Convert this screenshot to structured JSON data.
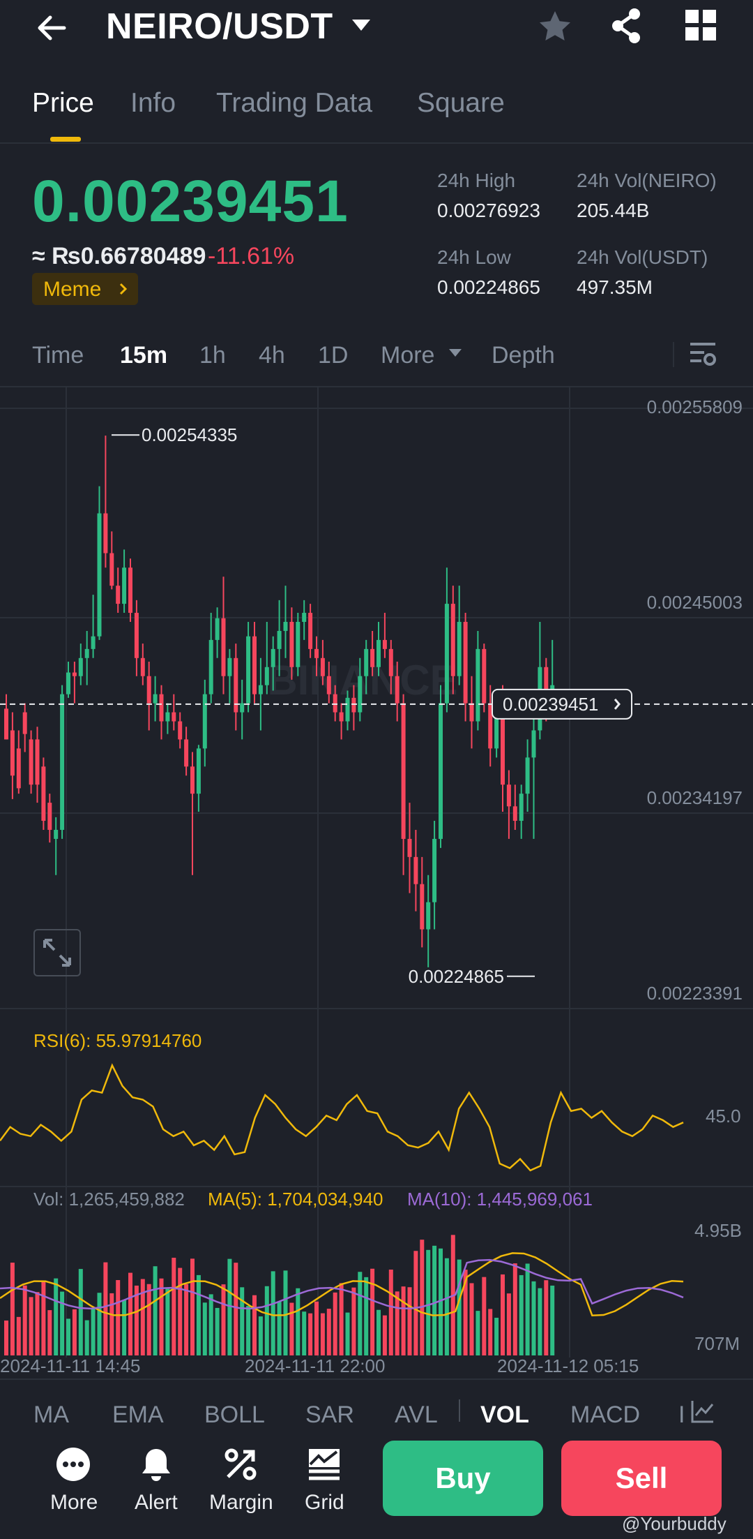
{
  "header": {
    "pair": "NEIRO/USDT",
    "back_icon": "arrow-left-icon",
    "favorite_icon": "star-icon",
    "share_icon": "share-icon",
    "grid_icon": "grid-icon"
  },
  "tabs": [
    {
      "label": "Price",
      "active": true
    },
    {
      "label": "Info"
    },
    {
      "label": "Trading Data"
    },
    {
      "label": "Square"
    }
  ],
  "price": {
    "last": "0.00239451",
    "fiat": "≈ ₨0.66780489",
    "change": "-11.61%",
    "tag": "Meme"
  },
  "stats": {
    "high_label": "24h High",
    "high_value": "0.00276923",
    "low_label": "24h Low",
    "low_value": "0.00224865",
    "vol_base_label": "24h Vol(NEIRO)",
    "vol_base_value": "205.44B",
    "vol_quote_label": "24h Vol(USDT)",
    "vol_quote_value": "497.35M"
  },
  "intervals": {
    "items": [
      "Time",
      "15m",
      "1h",
      "4h",
      "1D",
      "More",
      "Depth"
    ],
    "active": "15m"
  },
  "chart": {
    "axis_labels": [
      "0.00255809",
      "0.00245003",
      "0.00234197",
      "0.00223391"
    ],
    "high_marker": "0.00254335",
    "low_marker": "0.00224865",
    "current_price": "0.00239451",
    "watermark": "BINANCE"
  },
  "rsi": {
    "label": "RSI(6): 55.97914760",
    "axis": "45.0"
  },
  "volume": {
    "vol": "Vol: 1,265,459,882",
    "ma5": "MA(5): 1,704,034,940",
    "ma10": "MA(10): 1,445,969,061",
    "axis_top": "4.95B",
    "axis_bottom": "707M"
  },
  "time_axis": [
    "2024-11-11 14:45",
    "2024-11-11 22:00",
    "2024-11-12 05:15"
  ],
  "indicator_tabs": {
    "items": [
      "MA",
      "EMA",
      "BOLL",
      "SAR",
      "AVL",
      "VOL",
      "MACD",
      "I"
    ],
    "active": "VOL"
  },
  "bottom_actions": [
    {
      "label": "More",
      "icon": "more-dots-icon"
    },
    {
      "label": "Alert",
      "icon": "bell-icon"
    },
    {
      "label": "Margin",
      "icon": "margin-icon"
    },
    {
      "label": "Grid",
      "icon": "grid-bot-icon"
    }
  ],
  "buttons": {
    "buy": "Buy",
    "sell": "Sell"
  },
  "colors": {
    "up": "#2ebd85",
    "down": "#f6465d",
    "accent": "#f0b90b",
    "ma10": "#9c6ad6",
    "background": "#1e2129"
  },
  "chart_data": {
    "type": "candlestick",
    "y_range": [
      0.00223391,
      0.00255809
    ],
    "y_ticks": [
      0.00255809,
      0.00245003,
      0.00234197,
      0.00223391
    ],
    "high": 0.00254335,
    "low": 0.00224865,
    "last": 0.00239451,
    "candles": [
      [
        0.002392,
        0.0024,
        0.002375,
        0.002375
      ],
      [
        0.00238,
        0.00239,
        0.002342,
        0.002355
      ],
      [
        0.00237,
        0.00238,
        0.002345,
        0.002348
      ],
      [
        0.00239,
        0.002395,
        0.002368,
        0.002378
      ],
      [
        0.002375,
        0.00238,
        0.002345,
        0.00235
      ],
      [
        0.002375,
        0.002382,
        0.00234,
        0.00235
      ],
      [
        0.00236,
        0.002365,
        0.002325,
        0.00233
      ],
      [
        0.00234,
        0.002345,
        0.002318,
        0.002325
      ],
      [
        0.00232,
        0.002332,
        0.0023,
        0.002325
      ],
      [
        0.002325,
        0.002405,
        0.00232,
        0.0024
      ],
      [
        0.0024,
        0.002418,
        0.002398,
        0.002412
      ],
      [
        0.002412,
        0.002418,
        0.002395,
        0.00241
      ],
      [
        0.00241,
        0.002428,
        0.002405,
        0.00242
      ],
      [
        0.00242,
        0.002435,
        0.002405,
        0.002425
      ],
      [
        0.002425,
        0.002455,
        0.00242,
        0.002432
      ],
      [
        0.002432,
        0.002515,
        0.00243,
        0.0025
      ],
      [
        0.0025,
        0.002543,
        0.00247,
        0.002478
      ],
      [
        0.002478,
        0.00249,
        0.002458,
        0.00246
      ],
      [
        0.00246,
        0.00247,
        0.002445,
        0.00245
      ],
      [
        0.00245,
        0.00248,
        0.002445,
        0.00247
      ],
      [
        0.00247,
        0.002475,
        0.00244,
        0.002445
      ],
      [
        0.002445,
        0.002452,
        0.00241,
        0.00242
      ],
      [
        0.00242,
        0.002428,
        0.002405,
        0.00241
      ],
      [
        0.00241,
        0.002418,
        0.00238,
        0.002395
      ],
      [
        0.002395,
        0.00241,
        0.002385,
        0.0024
      ],
      [
        0.0024,
        0.002405,
        0.002375,
        0.002385
      ],
      [
        0.002385,
        0.002395,
        0.002378,
        0.00239
      ],
      [
        0.00239,
        0.0024,
        0.00238,
        0.002385
      ],
      [
        0.002385,
        0.00239,
        0.00237,
        0.002375
      ],
      [
        0.002375,
        0.002382,
        0.002355,
        0.00236
      ],
      [
        0.00236,
        0.002368,
        0.0023,
        0.002345
      ],
      [
        0.002345,
        0.002372,
        0.002335,
        0.00237
      ],
      [
        0.00237,
        0.002408,
        0.00236,
        0.0024
      ],
      [
        0.0024,
        0.002445,
        0.002395,
        0.00243
      ],
      [
        0.00243,
        0.002448,
        0.00242,
        0.002442
      ],
      [
        0.002442,
        0.002465,
        0.0024,
        0.00241
      ],
      [
        0.00241,
        0.002425,
        0.002395,
        0.00242
      ],
      [
        0.00242,
        0.002428,
        0.00238,
        0.00239
      ],
      [
        0.00239,
        0.002408,
        0.002375,
        0.002395
      ],
      [
        0.002395,
        0.00244,
        0.00239,
        0.002432
      ],
      [
        0.002432,
        0.00244,
        0.002395,
        0.0024
      ],
      [
        0.0024,
        0.00242,
        0.00238,
        0.002405
      ],
      [
        0.002405,
        0.00244,
        0.0024,
        0.002415
      ],
      [
        0.002415,
        0.002432,
        0.002402,
        0.002425
      ],
      [
        0.002425,
        0.002452,
        0.00241,
        0.002435
      ],
      [
        0.002435,
        0.00246,
        0.00242,
        0.00244
      ],
      [
        0.00244,
        0.002448,
        0.002408,
        0.002415
      ],
      [
        0.002415,
        0.002445,
        0.00241,
        0.00244
      ],
      [
        0.00244,
        0.002452,
        0.00243,
        0.002445
      ],
      [
        0.002445,
        0.00245,
        0.00242,
        0.002425
      ],
      [
        0.002425,
        0.002432,
        0.00241,
        0.00242
      ],
      [
        0.00242,
        0.00243,
        0.002405,
        0.00241
      ],
      [
        0.00241,
        0.002418,
        0.002395,
        0.0024
      ],
      [
        0.0024,
        0.002405,
        0.002385,
        0.00239
      ],
      [
        0.00239,
        0.002395,
        0.002375,
        0.002385
      ],
      [
        0.002385,
        0.002402,
        0.00238,
        0.002398
      ],
      [
        0.002398,
        0.002405,
        0.00238,
        0.00239
      ],
      [
        0.00239,
        0.00242,
        0.002385,
        0.00241
      ],
      [
        0.00241,
        0.00243,
        0.0024,
        0.002425
      ],
      [
        0.002425,
        0.002435,
        0.00241,
        0.002415
      ],
      [
        0.002415,
        0.00244,
        0.00241,
        0.00243
      ],
      [
        0.00243,
        0.002445,
        0.00242,
        0.002425
      ],
      [
        0.002425,
        0.00243,
        0.0024,
        0.00241
      ],
      [
        0.00241,
        0.002418,
        0.002385,
        0.002395
      ],
      [
        0.002395,
        0.0024,
        0.0023,
        0.00232
      ],
      [
        0.00232,
        0.00234,
        0.00229,
        0.00231
      ],
      [
        0.00231,
        0.002325,
        0.00228,
        0.002295
      ],
      [
        0.002295,
        0.00231,
        0.00226,
        0.00227
      ],
      [
        0.00227,
        0.0023,
        0.002249,
        0.002285
      ],
      [
        0.002285,
        0.00233,
        0.00227,
        0.00232
      ],
      [
        0.00232,
        0.002405,
        0.002315,
        0.002395
      ],
      [
        0.002395,
        0.00247,
        0.00239,
        0.00245
      ],
      [
        0.00245,
        0.00246,
        0.0024,
        0.00241
      ],
      [
        0.00241,
        0.00246,
        0.002405,
        0.00244
      ],
      [
        0.00244,
        0.002445,
        0.002385,
        0.002395
      ],
      [
        0.002395,
        0.00241,
        0.00237,
        0.002385
      ],
      [
        0.002385,
        0.002435,
        0.00238,
        0.002425
      ],
      [
        0.002425,
        0.002428,
        0.00239,
        0.002395
      ],
      [
        0.002395,
        0.002405,
        0.00236,
        0.00237
      ],
      [
        0.00237,
        0.0024,
        0.002365,
        0.00239
      ],
      [
        0.00239,
        0.002405,
        0.002335,
        0.00235
      ],
      [
        0.00235,
        0.002358,
        0.00232,
        0.002338
      ],
      [
        0.002338,
        0.00235,
        0.002325,
        0.00233
      ],
      [
        0.00233,
        0.00235,
        0.00232,
        0.002345
      ],
      [
        0.002345,
        0.002375,
        0.002335,
        0.002365
      ],
      [
        0.002365,
        0.002395,
        0.00232,
        0.00238
      ],
      [
        0.00238,
        0.00244,
        0.002375,
        0.002415
      ],
      [
        0.002415,
        0.00242,
        0.002385,
        0.002395
      ],
      [
        0.002395,
        0.00243,
        0.00239,
        0.002405
      ]
    ],
    "rsi": [
      42,
      48,
      45,
      44,
      49,
      46,
      42,
      46,
      60,
      64,
      63,
      75,
      66,
      61,
      60,
      57,
      47,
      44,
      46,
      40,
      42,
      38,
      44,
      36,
      37,
      52,
      62,
      58,
      52,
      47,
      44,
      48,
      53,
      51,
      58,
      62,
      55,
      54,
      46,
      44,
      40,
      39,
      41,
      46,
      38,
      56,
      63,
      56,
      48,
      32,
      30,
      34,
      29,
      31,
      50,
      63,
      55,
      56,
      52,
      55,
      50,
      46,
      44,
      47,
      53,
      51,
      48,
      50
    ]
  }
}
